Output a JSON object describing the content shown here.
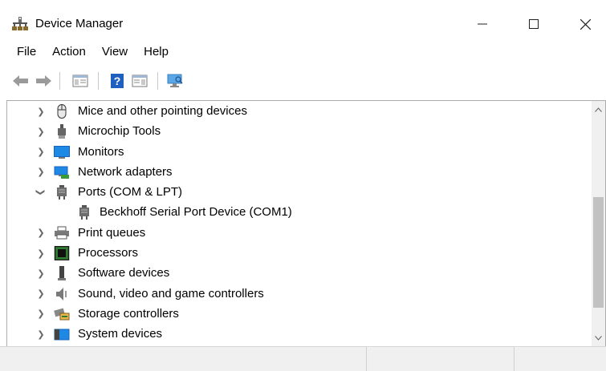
{
  "window": {
    "title": "Device Manager",
    "minimize_glyph": "—",
    "maximize_glyph": "☐",
    "close_glyph": "✕"
  },
  "menu": [
    "File",
    "Action",
    "View",
    "Help"
  ],
  "toolbar": [
    "back-icon",
    "forward-icon",
    "show-hide-console-tree-icon",
    "help-icon",
    "action-pane-icon",
    "scan-hardware-icon"
  ],
  "tree": [
    {
      "label": "Mice and other pointing devices",
      "icon": "mouse-icon",
      "expanded": false
    },
    {
      "label": "Microchip Tools",
      "icon": "connector-icon",
      "expanded": false
    },
    {
      "label": "Monitors",
      "icon": "monitor-icon",
      "expanded": false
    },
    {
      "label": "Network adapters",
      "icon": "network-adapter-icon",
      "expanded": false
    },
    {
      "label": "Ports (COM & LPT)",
      "icon": "port-icon",
      "expanded": true
    },
    {
      "label": "Beckhoff Serial Port Device (COM1)",
      "icon": "port-icon",
      "child": true
    },
    {
      "label": "Print queues",
      "icon": "printer-icon",
      "expanded": false
    },
    {
      "label": "Processors",
      "icon": "processor-icon",
      "expanded": false
    },
    {
      "label": "Software devices",
      "icon": "software-device-icon",
      "expanded": false
    },
    {
      "label": "Sound, video and game controllers",
      "icon": "speaker-icon",
      "expanded": false
    },
    {
      "label": "Storage controllers",
      "icon": "storage-controller-icon",
      "expanded": false
    },
    {
      "label": "System devices",
      "icon": "system-devices-icon",
      "expanded": false
    }
  ],
  "colors": {
    "monitor_blue": "#1e88e5",
    "network_green": "#3a9a3a",
    "help_blue": "#1f5fbf",
    "processor_green": "#2e7d32",
    "folder_yellow": "#e8b64a"
  }
}
